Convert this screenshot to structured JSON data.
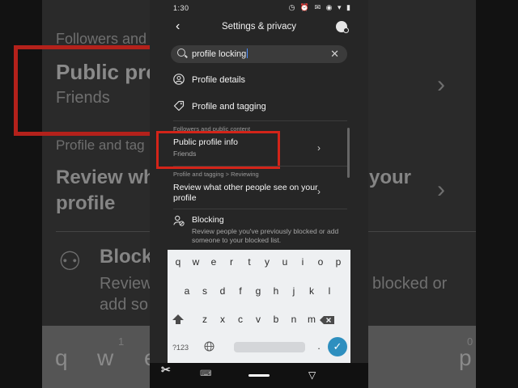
{
  "background": {
    "section_label": "Followers and",
    "item_title": "Public prof",
    "item_sub": "Friends",
    "section2": "Profile and tag",
    "review_line1": "Review wha",
    "review_line1_right": "your",
    "review_line2": "profile",
    "blocking": "Block",
    "blocking_desc1": "Review",
    "blocking_desc1_right": "blocked or",
    "blocking_desc2": "add so",
    "keys": [
      "q",
      "w",
      "e"
    ],
    "key_numbers": [
      "1",
      "2",
      "0"
    ],
    "key_p": "p"
  },
  "status": {
    "time": "1:30",
    "icons": "◷ ⏰ ✉ ◉ ▾ ▮"
  },
  "header": {
    "title": "Settings & privacy",
    "back_glyph": "‹"
  },
  "search": {
    "value": "profile locking",
    "clear_glyph": "✕"
  },
  "menu": {
    "profile_details": "Profile details",
    "profile_tagging": "Profile and tagging"
  },
  "results": [
    {
      "section": "Followers and public content",
      "title": "Public profile info",
      "subtitle": "Friends"
    },
    {
      "section": "Profile and tagging > Reviewing",
      "title": "Review what other people see on your profile"
    },
    {
      "title": "Blocking",
      "subtitle": "Review people you've previously blocked or add someone to your blocked list."
    }
  ],
  "keyboard": {
    "row1": [
      "q",
      "w",
      "e",
      "r",
      "t",
      "y",
      "u",
      "i",
      "o",
      "p"
    ],
    "row1_nums": [
      "1",
      "2",
      "3",
      "4",
      "5",
      "6",
      "7",
      "8",
      "9",
      "0"
    ],
    "row2": [
      "a",
      "s",
      "d",
      "f",
      "g",
      "h",
      "j",
      "k",
      "l"
    ],
    "row3": [
      "z",
      "x",
      "c",
      "v",
      "b",
      "n",
      "m"
    ],
    "sym": "?123",
    "period": "."
  },
  "colors": {
    "highlight": "#d32419",
    "enter": "#2e8fbf"
  }
}
